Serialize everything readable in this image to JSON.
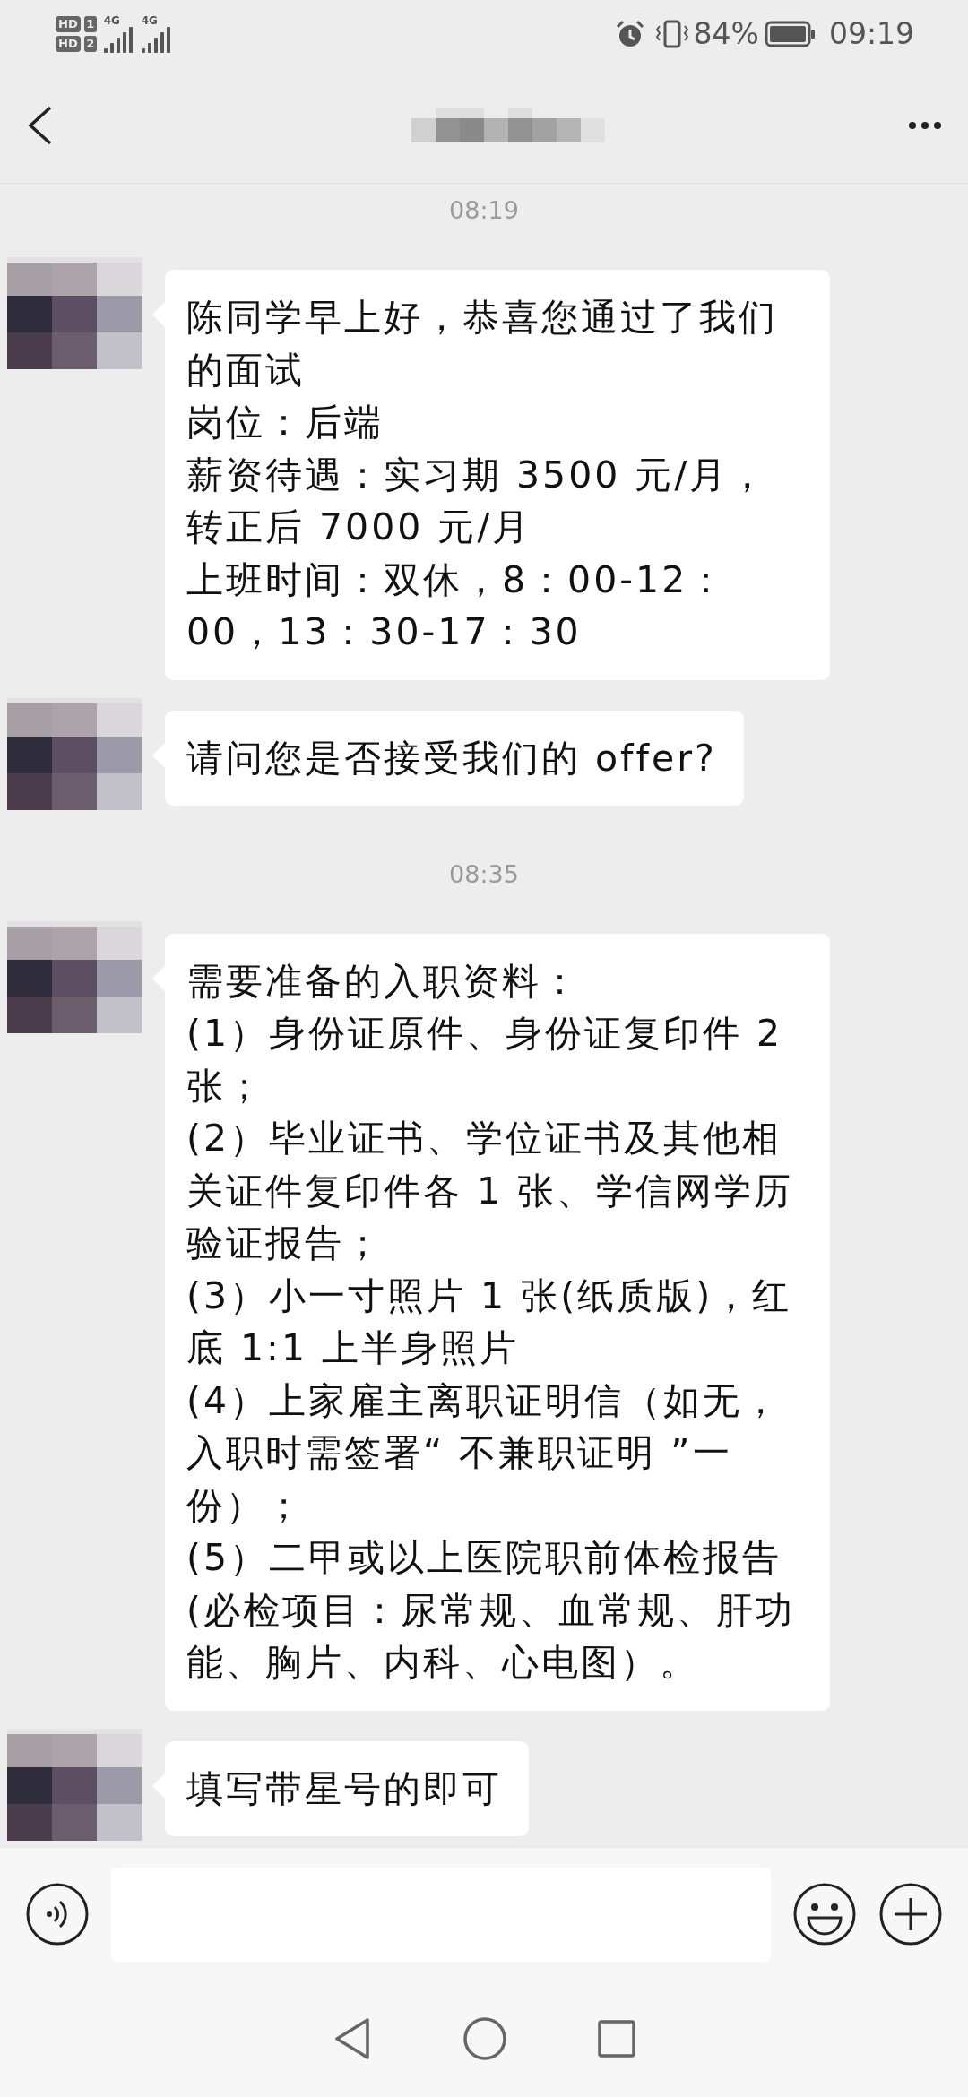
{
  "status_bar": {
    "sims": [
      {
        "badge": "HD",
        "slot": "1",
        "network": "4G"
      },
      {
        "badge": "HD",
        "slot": "2",
        "network": "4G"
      }
    ],
    "battery": "84%",
    "time": "09:19"
  },
  "messages": [
    {
      "kind": "time",
      "text": "08:19"
    },
    {
      "kind": "message",
      "lines": [
        "陈同学早上好，恭喜您通过了我们的面试",
        "岗位：后端",
        "薪资待遇：实习期 3500 元/月，转正后 7000 元/月",
        "上班时间：双休，8：00-12：00，13：30-17：30"
      ]
    },
    {
      "kind": "message",
      "lines": [
        "请问您是否接受我们的 offer?"
      ]
    },
    {
      "kind": "time",
      "text": "08:35"
    },
    {
      "kind": "message",
      "lines": [
        "需要准备的入职资料：",
        "(1）身份证原件、身份证复印件 2 张；",
        "(2）毕业证书、学位证书及其他相关证件复印件各 1 张、学信网学历验证报告；",
        "(3）小一寸照片 1 张(纸质版)，红底 1:1 上半身照片",
        "(4）上家雇主离职证明信（如无，入职时需签署“ 不兼职证明 ”一份）；",
        "(5）二甲或以上医院职前体检报告(必检项目：尿常规、血常规、肝功能、胸片、内科、心电图）。"
      ]
    },
    {
      "kind": "message",
      "lines": [
        "填写带星号的即可"
      ]
    }
  ]
}
